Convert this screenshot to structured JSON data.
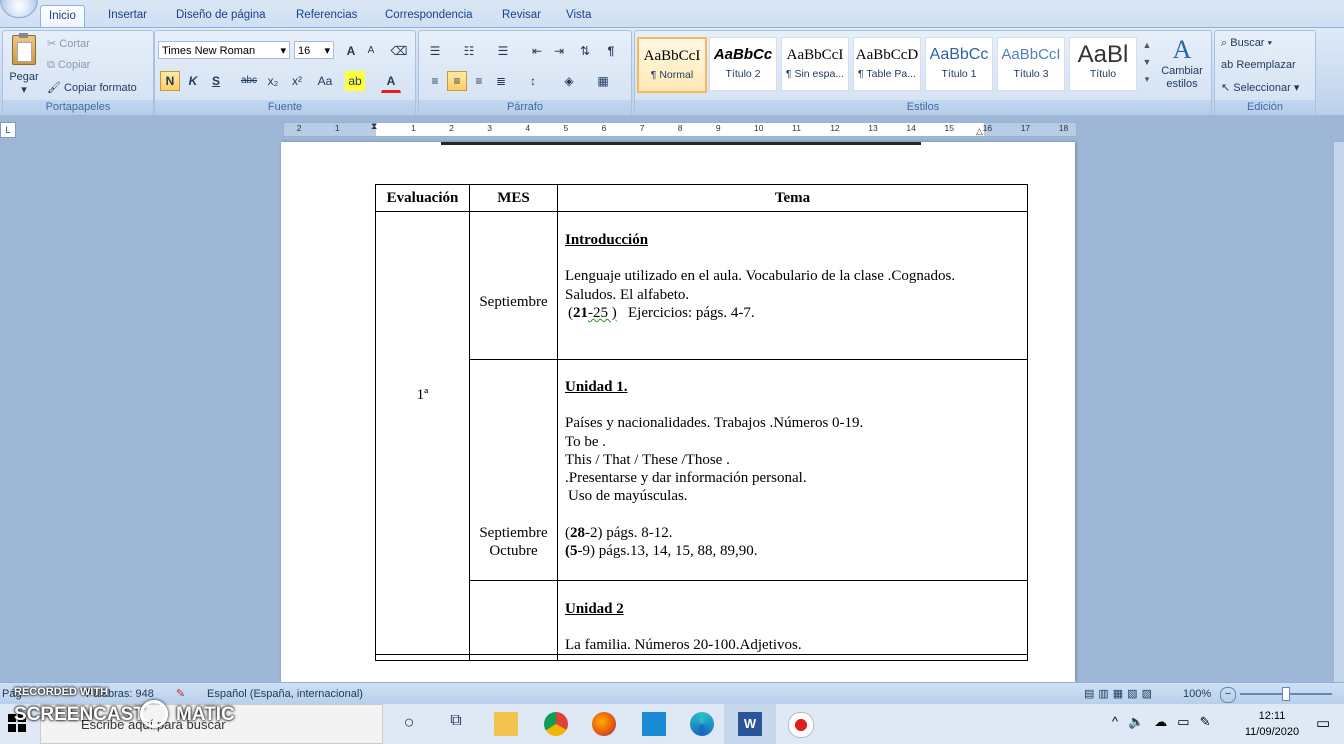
{
  "tabs": [
    "Inicio",
    "Insertar",
    "Diseño de página",
    "Referencias",
    "Correspondencia",
    "Revisar",
    "Vista"
  ],
  "clipboard": {
    "paste": "Pegar",
    "cut": "Cortar",
    "copy": "Copiar",
    "format_painter": "Copiar formato",
    "label": "Portapapeles"
  },
  "font": {
    "name": "Times New Roman",
    "size": "16",
    "label": "Fuente",
    "bold": "N",
    "italic": "K",
    "underline": "S",
    "strike": "abc",
    "sub": "x₂",
    "sup": "x²",
    "case": "Aa",
    "grow": "A",
    "shrink": "A"
  },
  "paragraph": {
    "label": "Párrafo"
  },
  "styles": {
    "label": "Estilos",
    "items": [
      {
        "preview": "AaBbCcI",
        "name": "¶ Normal"
      },
      {
        "preview": "AaBbCc",
        "name": "Título 2"
      },
      {
        "preview": "AaBbCcI",
        "name": "¶ Sin espa..."
      },
      {
        "preview": "AaBbCcD",
        "name": "¶ Table Pa..."
      },
      {
        "preview": "AaBbCc",
        "name": "Título 1"
      },
      {
        "preview": "AaBbCcI",
        "name": "Título 3"
      },
      {
        "preview": "AaBl",
        "name": "Título"
      }
    ],
    "change": "Cambiar estilos"
  },
  "editing": {
    "label": "Edición",
    "find": "Buscar",
    "replace": "Reemplazar",
    "select": "Seleccionar"
  },
  "ruler": {
    "numbers": [
      "2",
      "1",
      "1",
      "2",
      "3",
      "4",
      "5",
      "6",
      "7",
      "8",
      "9",
      "10",
      "11",
      "12",
      "13",
      "14",
      "15",
      "16",
      "17",
      "18"
    ]
  },
  "doc": {
    "headers": [
      "Evaluación",
      "MES",
      "Tema"
    ],
    "eval": "1ª",
    "rows": [
      {
        "mes": [
          "Septiembre"
        ],
        "title": "Introducción",
        "lines": [
          "Lenguaje utilizado en el aula. Vocabulario de la clase .Cognados.",
          "Saludos. El alfabeto."
        ],
        "pages_bold": "21",
        "pages_rest": "-25 )",
        "pages_tail": "   Ejercicios: págs. 4-7."
      },
      {
        "mes": [
          "Septiembre",
          "Octubre"
        ],
        "title": "Unidad 1.",
        "lines": [
          "Países y nacionalidades. Trabajos  .Números 0-19.",
          "To be .",
          "This / That / These /Those .",
          ".Presentarse y dar  información  personal.",
          "Uso de mayúsculas."
        ],
        "ref1_bold": "28",
        "ref1_rest": "-2)  págs. 8-12.",
        "ref2_bold": "5",
        "ref2_rest": "-9)  págs.13, 14, 15, 88, 89,90."
      },
      {
        "title": "Unidad 2",
        "lines": [
          "La familia. Números 20-100.Adjetivos."
        ]
      }
    ]
  },
  "status": {
    "page": "Pág",
    "words": "Palabras: 948",
    "lang": "Español (España, internacional)",
    "zoom": "100%"
  },
  "taskbar": {
    "search": "Escribe aquí para buscar",
    "time": "12:11",
    "date": "11/09/2020"
  },
  "watermark": {
    "recorded": "RECORDED WITH",
    "brand": "SCREENCAST",
    "brand2": "MATIC"
  }
}
